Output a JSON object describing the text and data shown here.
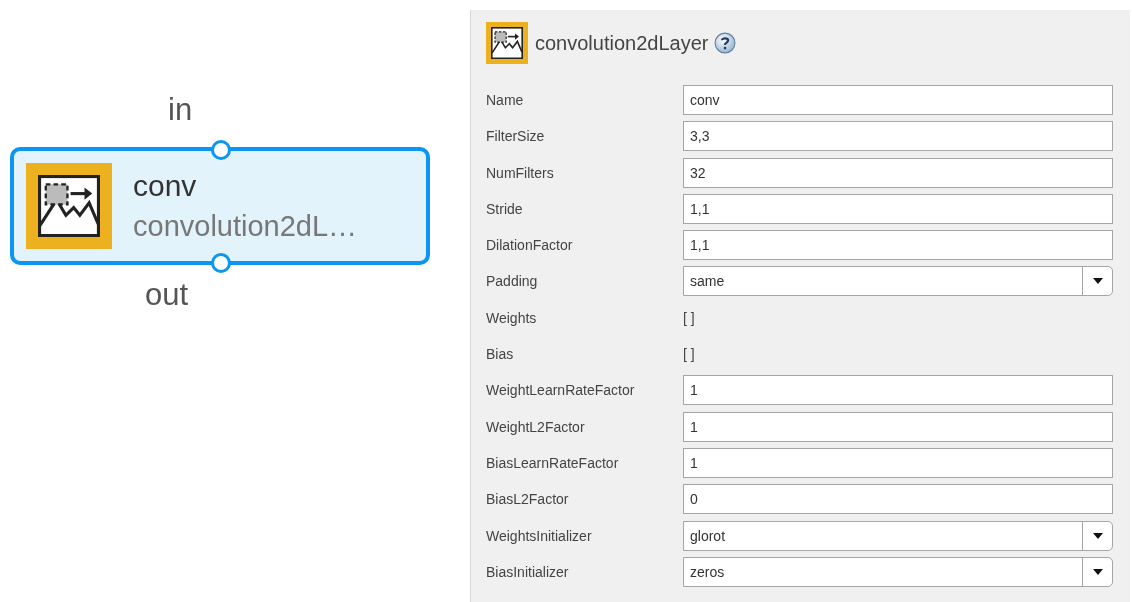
{
  "node": {
    "name": "conv",
    "type": "convolution2dL…",
    "input_label": "in",
    "output_label": "out",
    "selected": true
  },
  "panel": {
    "title": "convolution2dLayer",
    "properties": [
      {
        "label": "Name",
        "kind": "text",
        "value": "conv"
      },
      {
        "label": "FilterSize",
        "kind": "text",
        "value": "3,3"
      },
      {
        "label": "NumFilters",
        "kind": "text",
        "value": "32"
      },
      {
        "label": "Stride",
        "kind": "text",
        "value": "1,1"
      },
      {
        "label": "DilationFactor",
        "kind": "text",
        "value": "1,1"
      },
      {
        "label": "Padding",
        "kind": "dropdown",
        "value": "same"
      },
      {
        "label": "Weights",
        "kind": "static",
        "value": "[ ]"
      },
      {
        "label": "Bias",
        "kind": "static",
        "value": "[ ]"
      },
      {
        "label": "WeightLearnRateFactor",
        "kind": "text",
        "value": "1"
      },
      {
        "label": "WeightL2Factor",
        "kind": "text",
        "value": "1"
      },
      {
        "label": "BiasLearnRateFactor",
        "kind": "text",
        "value": "1"
      },
      {
        "label": "BiasL2Factor",
        "kind": "text",
        "value": "0"
      },
      {
        "label": "WeightsInitializer",
        "kind": "dropdown",
        "value": "glorot"
      },
      {
        "label": "BiasInitializer",
        "kind": "dropdown",
        "value": "zeros"
      }
    ]
  }
}
